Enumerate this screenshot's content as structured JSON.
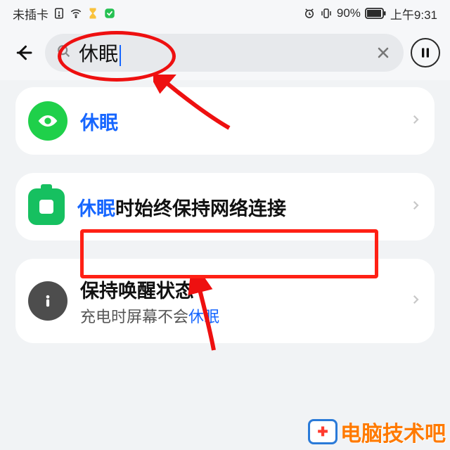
{
  "statusbar": {
    "left_label": "未插卡",
    "battery_pct": "90%",
    "time": "上午9:31"
  },
  "search": {
    "value": "休眠",
    "placeholder": ""
  },
  "results": [
    {
      "title_hl": "休眠",
      "title_rest": "",
      "subtitle_pre": "",
      "subtitle_hl": "",
      "subtitle_post": ""
    },
    {
      "title_hl": "休眠",
      "title_rest": "时始终保持网络连接",
      "subtitle_pre": "",
      "subtitle_hl": "",
      "subtitle_post": ""
    },
    {
      "title_hl": "",
      "title_rest": "保持唤醒状态",
      "subtitle_pre": "充电时屏幕不会",
      "subtitle_hl": "休眠",
      "subtitle_post": ""
    }
  ],
  "watermark": {
    "text": "电脑技术吧"
  },
  "colors": {
    "highlight": "#1666ff",
    "annotation": "#ee1010",
    "brand": "#ff7a00"
  }
}
